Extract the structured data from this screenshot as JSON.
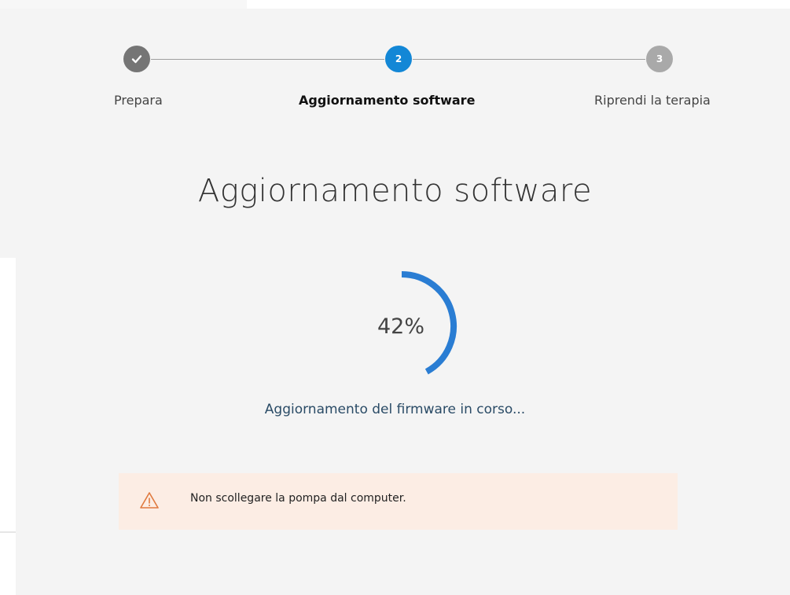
{
  "stepper": {
    "steps": [
      {
        "number": "",
        "label": "Prepara",
        "state": "completed",
        "icon": "check-icon"
      },
      {
        "number": "2",
        "label": "Aggiornamento software",
        "state": "active"
      },
      {
        "number": "3",
        "label": "Riprendi la terapia",
        "state": "pending"
      }
    ]
  },
  "main": {
    "title": "Aggiornamento software",
    "progress": {
      "percent": 42,
      "label": "42%",
      "status": "Aggiornamento del firmware in corso..."
    },
    "warning": {
      "text": "Non scollegare la pompa dal computer.",
      "icon": "warning-triangle-icon"
    }
  },
  "colors": {
    "accent": "#1387d6",
    "progress_ring": "#2a7dd3",
    "step_completed": "#757575",
    "step_pending": "#a9a9a9",
    "warning_background": "#fcede4",
    "warning_icon": "#e07a3f"
  }
}
